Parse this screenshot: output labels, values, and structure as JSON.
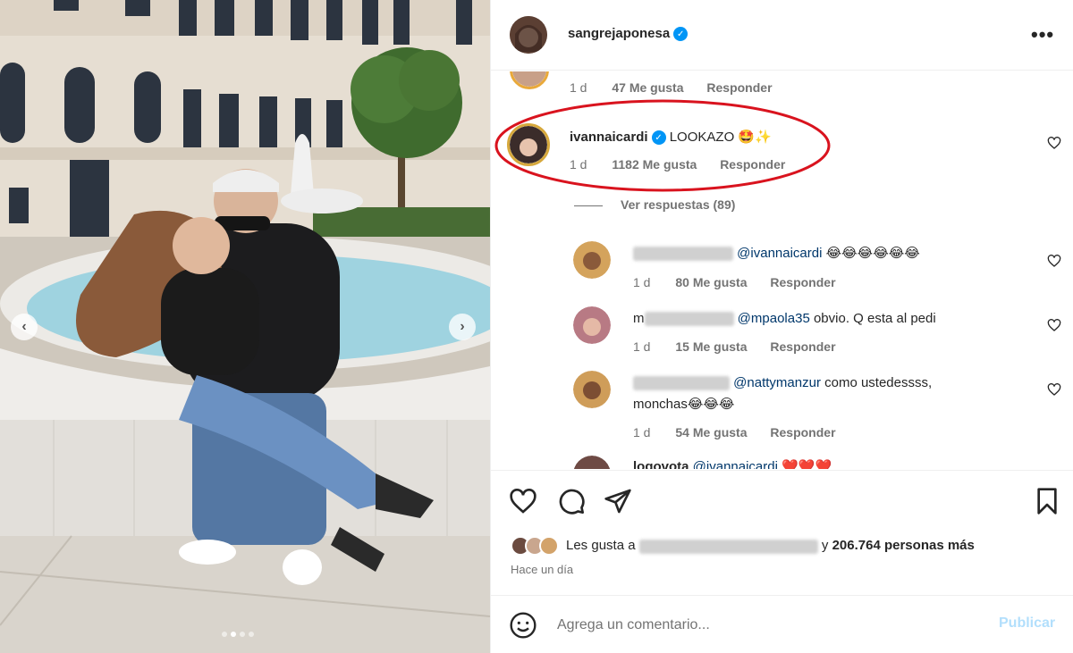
{
  "post": {
    "author": "sangrejaponesa",
    "more_label": "•••",
    "carousel_prev": "‹",
    "carousel_next": "›"
  },
  "comments": {
    "first_meta": {
      "time": "1 d",
      "likes": "47 Me gusta",
      "reply": "Responder"
    },
    "highlighted": {
      "username": "ivannaicardi",
      "text": "LOOKAZO",
      "emoji": "🤩✨",
      "time": "1 d",
      "likes": "1182 Me gusta",
      "reply": "Responder"
    },
    "view_replies": "Ver respuestas (89)",
    "replies": [
      {
        "mention": "@ivannaicardi",
        "text": "",
        "emoji": "😂😂😂😂😂😂",
        "time": "1 d",
        "likes": "80 Me gusta",
        "reply": "Responder"
      },
      {
        "user_prefix": "m",
        "mention": "@mpaola35",
        "text": "obvio. Q esta al pedi",
        "emoji": "",
        "time": "1 d",
        "likes": "15 Me gusta",
        "reply": "Responder"
      },
      {
        "mention": "@nattymanzur",
        "text": "como ustedessss,",
        "line2": "monchas",
        "emoji": "😂😂😂",
        "time": "1 d",
        "likes": "54 Me gusta",
        "reply": "Responder"
      },
      {
        "username": "logovota",
        "mention": "@ivannaicardi",
        "emoji": "❤️❤️❤️"
      }
    ]
  },
  "likes": {
    "prefix": "Les gusta a",
    "connector": "y",
    "count": "206.764 personas más",
    "time_ago": "Hace un día"
  },
  "composer": {
    "placeholder": "Agrega un comentario...",
    "publish": "Publicar"
  },
  "colors": {
    "verified": "#0095f6",
    "mention": "#00376b",
    "publish_disabled": "#b2dffc",
    "highlight_ellipse": "#d9131e"
  },
  "icons": [
    "heart-icon",
    "comment-icon",
    "share-icon",
    "bookmark-icon",
    "emoji-icon",
    "verified-icon",
    "more-icon"
  ]
}
